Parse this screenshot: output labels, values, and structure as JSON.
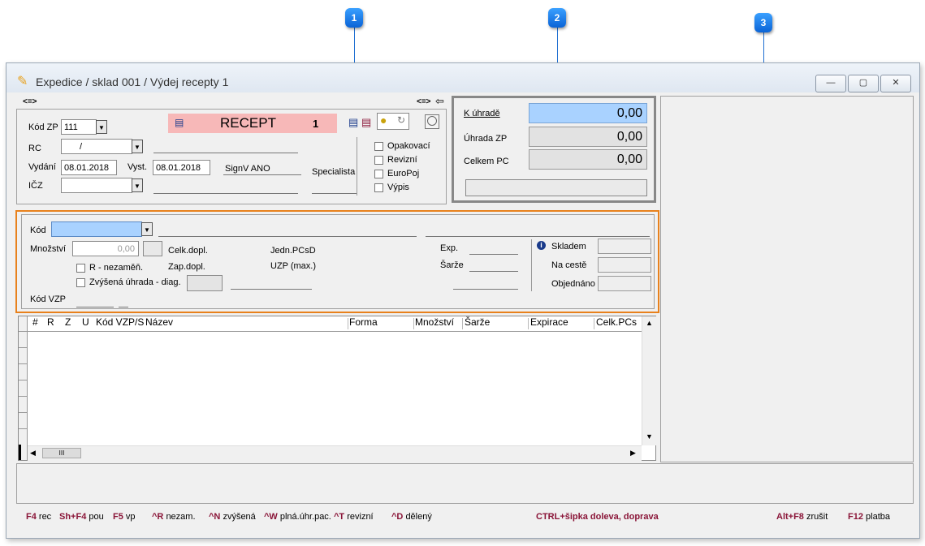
{
  "callouts": [
    "1",
    "2",
    "3"
  ],
  "window": {
    "title": "Expedice / sklad 001 / Výdej recepty 1",
    "nav_left": "<=>",
    "nav_right": "<=>",
    "controls": {
      "minimize": "—",
      "maximize": "▢",
      "close": "✕"
    }
  },
  "header": {
    "kod_zp_label": "Kód ZP",
    "kod_zp_value": "111",
    "rc_label": "RC",
    "rc_value": "/",
    "vydani_label": "Vydání",
    "vydani_value": "08.01.2018",
    "vyst_label": "Vyst.",
    "vyst_value": "08.01.2018",
    "signv": "SignV ANO",
    "specialista": "Specialista",
    "icz_label": "IČZ",
    "icz_value": "",
    "recept_label": "RECEPT",
    "recept_number": "1",
    "checkboxes": [
      "Opakovací",
      "Revizní",
      "EuroPoj",
      "Výpis"
    ]
  },
  "payment": {
    "k_uhrade_label": "K úhradě",
    "k_uhrade_value": "0,00",
    "uhrada_zp_label": "Úhrada ZP",
    "uhrada_zp_value": "0,00",
    "celkem_pc_label": "Celkem PC",
    "celkem_pc_value": "0,00"
  },
  "item": {
    "kod_label": "Kód",
    "mnozstvi_label": "Množství",
    "mnozstvi_value": "0,00",
    "celk_dopl": "Celk.dopl.",
    "zap_dopl": "Zap.dopl.",
    "jedn_pcsd": "Jedn.PCsD",
    "uzp_max": "UZP (max.)",
    "r_nezamen": "R - nezaměň.",
    "zvysena": "Zvýšená úhrada - diag.",
    "kod_vzp": "Kód VZP",
    "exp": "Exp.",
    "sarze": "Šarže",
    "skladem": "Skladem",
    "na_ceste": "Na cestě",
    "objednano": "Objednáno"
  },
  "table": {
    "columns": [
      "#",
      "R",
      "Z",
      "U",
      "Kód VZP/S",
      "Název",
      "Forma",
      "Množství",
      "Šarže",
      "Expirace",
      "Celk.PCs"
    ]
  },
  "shortcuts": [
    {
      "key": "F4",
      "label": "rec"
    },
    {
      "key": "Sh+F4",
      "label": "pou"
    },
    {
      "key": "F5",
      "label": "vp"
    },
    {
      "key": "^R",
      "label": "nezam."
    },
    {
      "key": "^N",
      "label": "zvýšená"
    },
    {
      "key": "^W",
      "label": "plná.úhr.pac."
    },
    {
      "key": "^T",
      "label": "revizní"
    },
    {
      "key": "^D",
      "label": "dělený"
    },
    {
      "key": "CTRL+šipka doleva, doprava",
      "label": ""
    },
    {
      "key": "Alt+F8",
      "label": "zrušit"
    },
    {
      "key": "F12",
      "label": "platba"
    }
  ],
  "colors": {
    "accent_orange": "#e8811c",
    "callout_blue": "#1f6fd1",
    "recept_bg": "#f7b8b8",
    "k_uhrade_bg": "#a9d2ff",
    "shortcut_key": "#8a1538"
  }
}
